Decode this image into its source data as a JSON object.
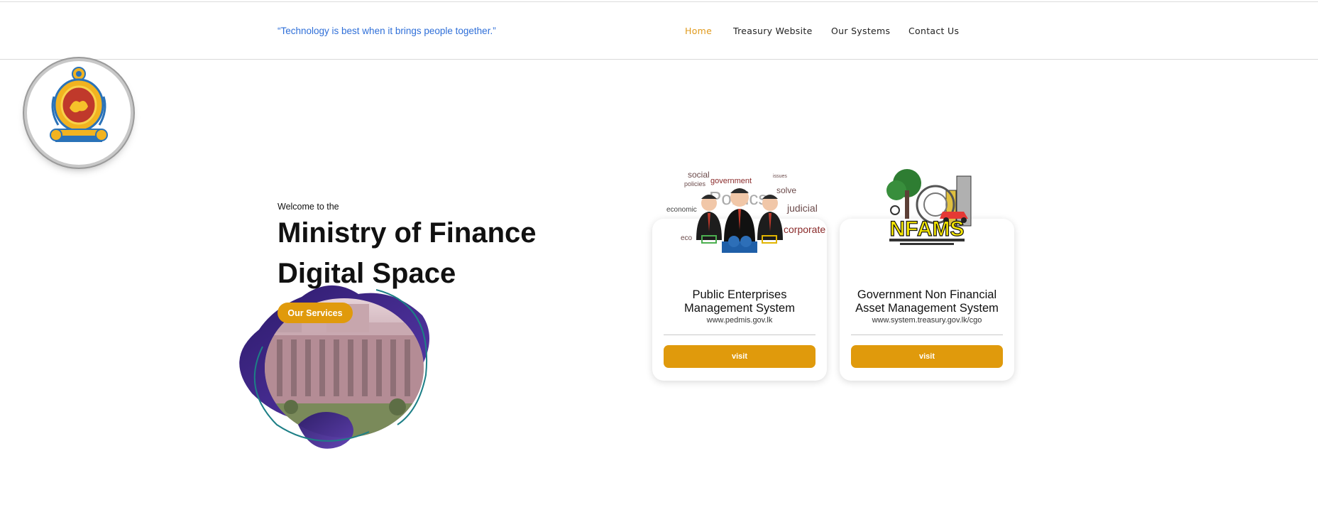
{
  "header": {
    "tagline": "“Technology is best when it brings people together.”",
    "nav": [
      {
        "label": "Home",
        "active": true
      },
      {
        "label": "Treasury Website",
        "active": false
      },
      {
        "label": "Our Systems",
        "active": false
      },
      {
        "label": "Contact Us",
        "active": false
      }
    ]
  },
  "hero": {
    "welcome": "Welcome to the",
    "title_line1": "Ministry of Finance",
    "title_line2": "Digital Space",
    "services_button": "Our Services"
  },
  "cards": [
    {
      "title_line1": "Public Enterprises",
      "title_line2": "Management System",
      "url": "www.pedmis.gov.lk",
      "button": "visit",
      "icon": "business-people-word-cloud-icon"
    },
    {
      "title_line1": "Government Non Financial",
      "title_line2": "Asset Management System",
      "url": "www.system.treasury.gov.lk/cgo",
      "button": "visit",
      "icon": "nfams-logo",
      "logo_text": "NFAMS"
    }
  ],
  "colors": {
    "accent": "#e09a0c",
    "active_nav": "#e09a1c",
    "tagline": "#2f6fd8",
    "hero_purple": "#3b2a8a",
    "hero_teal": "#1d7f86"
  }
}
